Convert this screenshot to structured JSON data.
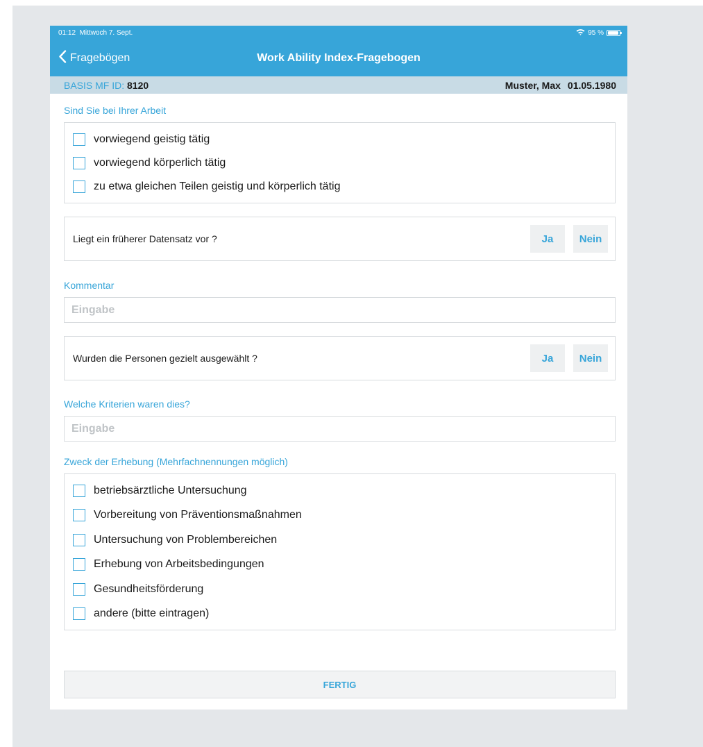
{
  "status_bar": {
    "time": "01:12",
    "date": "Mittwoch 7. Sept.",
    "battery": "95 %"
  },
  "nav": {
    "back_label": "Fragebögen",
    "title": "Work Ability Index-Fragebogen"
  },
  "patient": {
    "id_label": "BASIS MF ID:",
    "id_value": "8120",
    "name": "Muster, Max",
    "birthdate": "01.05.1980"
  },
  "work_type": {
    "label": "Sind Sie bei Ihrer Arbeit",
    "options": [
      "vorwiegend geistig tätig",
      "vorwiegend körperlich tätig",
      "zu etwa gleichen Teilen geistig und körperlich tätig"
    ]
  },
  "previous_dataset": {
    "question": "Liegt ein früherer Datensatz vor ?",
    "yes": "Ja",
    "no": "Nein"
  },
  "comment": {
    "label": "Kommentar",
    "placeholder": "Eingabe"
  },
  "selected_persons": {
    "question": "Wurden die Personen gezielt ausgewählt ?",
    "yes": "Ja",
    "no": "Nein"
  },
  "criteria": {
    "label": "Welche Kriterien waren dies?",
    "placeholder": "Eingabe"
  },
  "purpose": {
    "label": "Zweck der Erhebung (Mehrfachnennungen möglich)",
    "options": [
      "betriebsärztliche Untersuchung",
      "Vorbereitung von Präventionsmaßnahmen",
      "Untersuchung von Problembereichen",
      "Erhebung von Arbeitsbedingungen",
      "Gesundheitsförderung",
      "andere (bitte eintragen)"
    ]
  },
  "done_label": "FERTIG",
  "colors": {
    "accent": "#37a5d9",
    "patient_bar": "#c8dbe5",
    "backdrop": "#e4e7ea"
  }
}
